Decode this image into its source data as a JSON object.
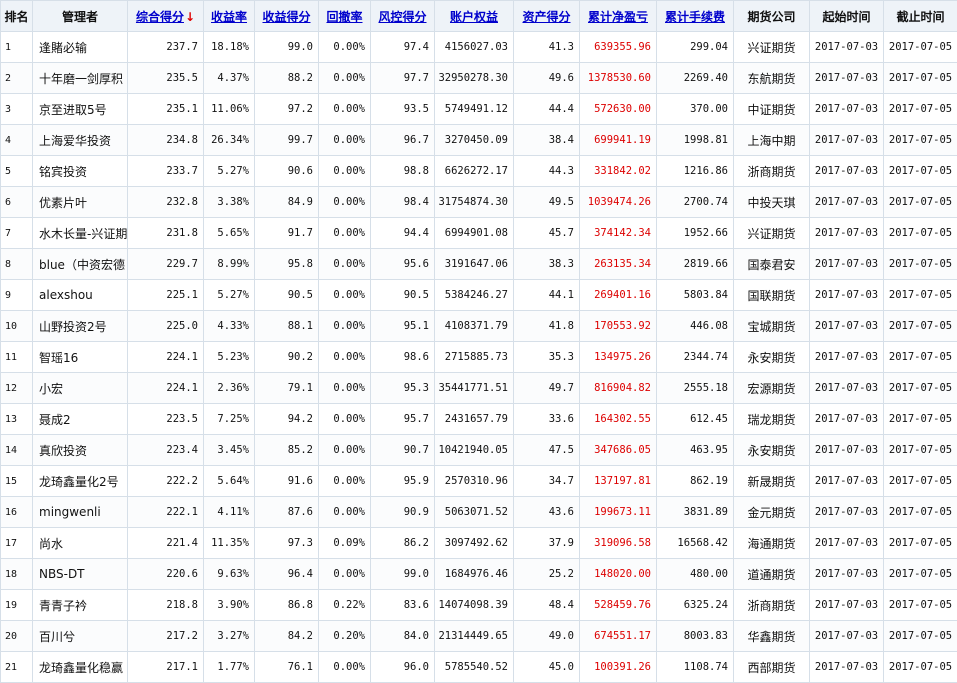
{
  "headers": [
    {
      "label": "排名",
      "link": false,
      "name": "header-rank"
    },
    {
      "label": "管理者",
      "link": false,
      "name": "header-manager"
    },
    {
      "label": "综合得分",
      "link": true,
      "sorted": true,
      "name": "header-composite-score"
    },
    {
      "label": "收益率",
      "link": true,
      "name": "header-return-rate"
    },
    {
      "label": "收益得分",
      "link": true,
      "name": "header-return-score"
    },
    {
      "label": "回撤率",
      "link": true,
      "name": "header-drawdown-rate"
    },
    {
      "label": "风控得分",
      "link": true,
      "name": "header-risk-score"
    },
    {
      "label": "账户权益",
      "link": true,
      "name": "header-account-equity"
    },
    {
      "label": "资产得分",
      "link": true,
      "name": "header-asset-score"
    },
    {
      "label": "累计净盈亏",
      "link": true,
      "name": "header-cum-net-pnl"
    },
    {
      "label": "累计手续费",
      "link": true,
      "name": "header-cum-fees"
    },
    {
      "label": "期货公司",
      "link": false,
      "name": "header-futures-company"
    },
    {
      "label": "起始时间",
      "link": false,
      "name": "header-start-date"
    },
    {
      "label": "截止时间",
      "link": false,
      "name": "header-end-date"
    }
  ],
  "sort_arrow": "↓",
  "sort_arrow_color": "#e00000",
  "pnl_color": "#dd0000",
  "link_color": "#0000cc",
  "rows": [
    {
      "rank": "1",
      "manager": "逢賭必输",
      "composite": "237.7",
      "return_rate": "18.18%",
      "return_score": "99.0",
      "drawdown": "0.00%",
      "risk_score": "97.4",
      "equity": "4156027.03",
      "asset_score": "41.3",
      "net_pnl": "639355.96",
      "fees": "299.04",
      "company": "兴证期货",
      "start": "2017-07-03",
      "end": "2017-07-05"
    },
    {
      "rank": "2",
      "manager": "十年磨一剑厚积",
      "composite": "235.5",
      "return_rate": "4.37%",
      "return_score": "88.2",
      "drawdown": "0.00%",
      "risk_score": "97.7",
      "equity": "32950278.30",
      "asset_score": "49.6",
      "net_pnl": "1378530.60",
      "fees": "2269.40",
      "company": "东航期货",
      "start": "2017-07-03",
      "end": "2017-07-05"
    },
    {
      "rank": "3",
      "manager": "京至进取5号",
      "composite": "235.1",
      "return_rate": "11.06%",
      "return_score": "97.2",
      "drawdown": "0.00%",
      "risk_score": "93.5",
      "equity": "5749491.12",
      "asset_score": "44.4",
      "net_pnl": "572630.00",
      "fees": "370.00",
      "company": "中证期货",
      "start": "2017-07-03",
      "end": "2017-07-05"
    },
    {
      "rank": "4",
      "manager": "上海爱华投资",
      "composite": "234.8",
      "return_rate": "26.34%",
      "return_score": "99.7",
      "drawdown": "0.00%",
      "risk_score": "96.7",
      "equity": "3270450.09",
      "asset_score": "38.4",
      "net_pnl": "699941.19",
      "fees": "1998.81",
      "company": "上海中期",
      "start": "2017-07-03",
      "end": "2017-07-05"
    },
    {
      "rank": "5",
      "manager": "铭宾投资",
      "composite": "233.7",
      "return_rate": "5.27%",
      "return_score": "90.6",
      "drawdown": "0.00%",
      "risk_score": "98.8",
      "equity": "6626272.17",
      "asset_score": "44.3",
      "net_pnl": "331842.02",
      "fees": "1216.86",
      "company": "浙商期货",
      "start": "2017-07-03",
      "end": "2017-07-05"
    },
    {
      "rank": "6",
      "manager": "优素片叶",
      "composite": "232.8",
      "return_rate": "3.38%",
      "return_score": "84.9",
      "drawdown": "0.00%",
      "risk_score": "98.4",
      "equity": "31754874.30",
      "asset_score": "49.5",
      "net_pnl": "1039474.26",
      "fees": "2700.74",
      "company": "中投天琪",
      "start": "2017-07-03",
      "end": "2017-07-05"
    },
    {
      "rank": "7",
      "manager": "水木长量-兴证期",
      "composite": "231.8",
      "return_rate": "5.65%",
      "return_score": "91.7",
      "drawdown": "0.00%",
      "risk_score": "94.4",
      "equity": "6994901.08",
      "asset_score": "45.7",
      "net_pnl": "374142.34",
      "fees": "1952.66",
      "company": "兴证期货",
      "start": "2017-07-03",
      "end": "2017-07-05"
    },
    {
      "rank": "8",
      "manager": "blue（中资宏德",
      "composite": "229.7",
      "return_rate": "8.99%",
      "return_score": "95.8",
      "drawdown": "0.00%",
      "risk_score": "95.6",
      "equity": "3191647.06",
      "asset_score": "38.3",
      "net_pnl": "263135.34",
      "fees": "2819.66",
      "company": "国泰君安",
      "start": "2017-07-03",
      "end": "2017-07-05"
    },
    {
      "rank": "9",
      "manager": "alexshou",
      "composite": "225.1",
      "return_rate": "5.27%",
      "return_score": "90.5",
      "drawdown": "0.00%",
      "risk_score": "90.5",
      "equity": "5384246.27",
      "asset_score": "44.1",
      "net_pnl": "269401.16",
      "fees": "5803.84",
      "company": "国联期货",
      "start": "2017-07-03",
      "end": "2017-07-05"
    },
    {
      "rank": "10",
      "manager": "山野投资2号",
      "composite": "225.0",
      "return_rate": "4.33%",
      "return_score": "88.1",
      "drawdown": "0.00%",
      "risk_score": "95.1",
      "equity": "4108371.79",
      "asset_score": "41.8",
      "net_pnl": "170553.92",
      "fees": "446.08",
      "company": "宝城期货",
      "start": "2017-07-03",
      "end": "2017-07-05"
    },
    {
      "rank": "11",
      "manager": "智瑶16",
      "composite": "224.1",
      "return_rate": "5.23%",
      "return_score": "90.2",
      "drawdown": "0.00%",
      "risk_score": "98.6",
      "equity": "2715885.73",
      "asset_score": "35.3",
      "net_pnl": "134975.26",
      "fees": "2344.74",
      "company": "永安期货",
      "start": "2017-07-03",
      "end": "2017-07-05"
    },
    {
      "rank": "12",
      "manager": "小宏",
      "composite": "224.1",
      "return_rate": "2.36%",
      "return_score": "79.1",
      "drawdown": "0.00%",
      "risk_score": "95.3",
      "equity": "35441771.51",
      "asset_score": "49.7",
      "net_pnl": "816904.82",
      "fees": "2555.18",
      "company": "宏源期货",
      "start": "2017-07-03",
      "end": "2017-07-05"
    },
    {
      "rank": "13",
      "manager": "聂成2",
      "composite": "223.5",
      "return_rate": "7.25%",
      "return_score": "94.2",
      "drawdown": "0.00%",
      "risk_score": "95.7",
      "equity": "2431657.79",
      "asset_score": "33.6",
      "net_pnl": "164302.55",
      "fees": "612.45",
      "company": "瑞龙期货",
      "start": "2017-07-03",
      "end": "2017-07-05"
    },
    {
      "rank": "14",
      "manager": "真欣投资",
      "composite": "223.4",
      "return_rate": "3.45%",
      "return_score": "85.2",
      "drawdown": "0.00%",
      "risk_score": "90.7",
      "equity": "10421940.05",
      "asset_score": "47.5",
      "net_pnl": "347686.05",
      "fees": "463.95",
      "company": "永安期货",
      "start": "2017-07-03",
      "end": "2017-07-05"
    },
    {
      "rank": "15",
      "manager": "龙琦鑫量化2号",
      "composite": "222.2",
      "return_rate": "5.64%",
      "return_score": "91.6",
      "drawdown": "0.00%",
      "risk_score": "95.9",
      "equity": "2570310.96",
      "asset_score": "34.7",
      "net_pnl": "137197.81",
      "fees": "862.19",
      "company": "新晟期货",
      "start": "2017-07-03",
      "end": "2017-07-05"
    },
    {
      "rank": "16",
      "manager": "mingwenli",
      "composite": "222.1",
      "return_rate": "4.11%",
      "return_score": "87.6",
      "drawdown": "0.00%",
      "risk_score": "90.9",
      "equity": "5063071.52",
      "asset_score": "43.6",
      "net_pnl": "199673.11",
      "fees": "3831.89",
      "company": "金元期货",
      "start": "2017-07-03",
      "end": "2017-07-05"
    },
    {
      "rank": "17",
      "manager": "尚水",
      "composite": "221.4",
      "return_rate": "11.35%",
      "return_score": "97.3",
      "drawdown": "0.09%",
      "risk_score": "86.2",
      "equity": "3097492.62",
      "asset_score": "37.9",
      "net_pnl": "319096.58",
      "fees": "16568.42",
      "company": "海通期货",
      "start": "2017-07-03",
      "end": "2017-07-05"
    },
    {
      "rank": "18",
      "manager": "NBS-DT",
      "composite": "220.6",
      "return_rate": "9.63%",
      "return_score": "96.4",
      "drawdown": "0.00%",
      "risk_score": "99.0",
      "equity": "1684976.46",
      "asset_score": "25.2",
      "net_pnl": "148020.00",
      "fees": "480.00",
      "company": "道通期货",
      "start": "2017-07-03",
      "end": "2017-07-05"
    },
    {
      "rank": "19",
      "manager": "青青子衿",
      "composite": "218.8",
      "return_rate": "3.90%",
      "return_score": "86.8",
      "drawdown": "0.22%",
      "risk_score": "83.6",
      "equity": "14074098.39",
      "asset_score": "48.4",
      "net_pnl": "528459.76",
      "fees": "6325.24",
      "company": "浙商期货",
      "start": "2017-07-03",
      "end": "2017-07-05"
    },
    {
      "rank": "20",
      "manager": "百川兮",
      "composite": "217.2",
      "return_rate": "3.27%",
      "return_score": "84.2",
      "drawdown": "0.20%",
      "risk_score": "84.0",
      "equity": "21314449.65",
      "asset_score": "49.0",
      "net_pnl": "674551.17",
      "fees": "8003.83",
      "company": "华鑫期货",
      "start": "2017-07-03",
      "end": "2017-07-05"
    },
    {
      "rank": "21",
      "manager": "龙琦鑫量化稳赢",
      "composite": "217.1",
      "return_rate": "1.77%",
      "return_score": "76.1",
      "drawdown": "0.00%",
      "risk_score": "96.0",
      "equity": "5785540.52",
      "asset_score": "45.0",
      "net_pnl": "100391.26",
      "fees": "1108.74",
      "company": "西部期货",
      "start": "2017-07-03",
      "end": "2017-07-05"
    }
  ]
}
